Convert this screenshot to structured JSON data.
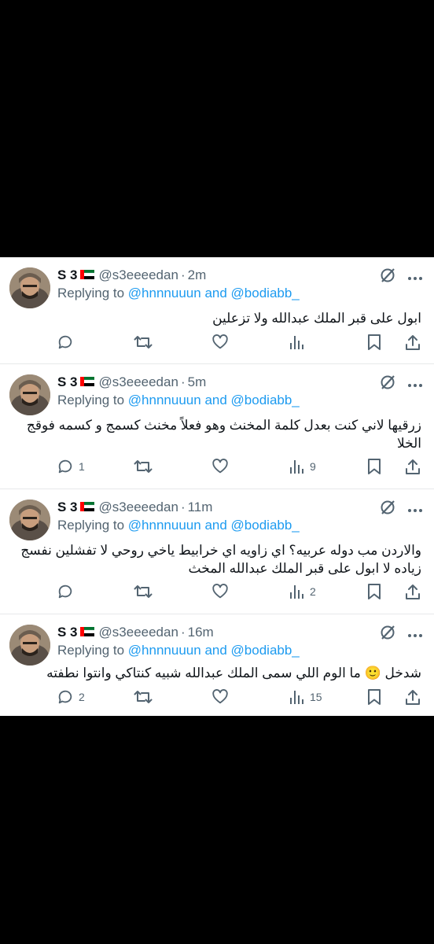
{
  "user": {
    "name": "S 3",
    "handle": "@s3eeeedan",
    "replying_label": "Replying to",
    "mention1": "@hnnnuuun",
    "and_word": "and",
    "mention2": "@bodiabb_"
  },
  "colors": {
    "link": "#1d9bf0",
    "text": "#0f1419",
    "muted": "#536471",
    "divider": "#e7e9ea"
  },
  "icons": [
    "flag-uae-icon",
    "grok-icon",
    "more-icon",
    "reply-icon",
    "retweet-icon",
    "like-icon",
    "views-icon",
    "bookmark-icon",
    "share-icon"
  ],
  "tweets": [
    {
      "time": "2m",
      "text": "ابول على قبر الملك عبدالله ولا تزعلين",
      "replies": "",
      "views": ""
    },
    {
      "time": "5m",
      "text": "زرقيها لاني كنت بعدل كلمة المخنث وهو فعلاً مخنث كسمج و كسمه فوقج الخلا",
      "replies": "1",
      "views": "9"
    },
    {
      "time": "11m",
      "text": "والاردن مب دوله عربيه؟ اي زاويه اي خرابيط ياخي روحي لا تفشلين نفسج زياده لا ابول على قبر الملك عبدالله المخث",
      "replies": "",
      "views": "2"
    },
    {
      "time": "16m",
      "text": "شدخل 🙂 ما الوم اللي سمى الملك عبدالله شبيه كنتاكي وانتوا نطفته",
      "replies": "2",
      "views": "15"
    }
  ]
}
